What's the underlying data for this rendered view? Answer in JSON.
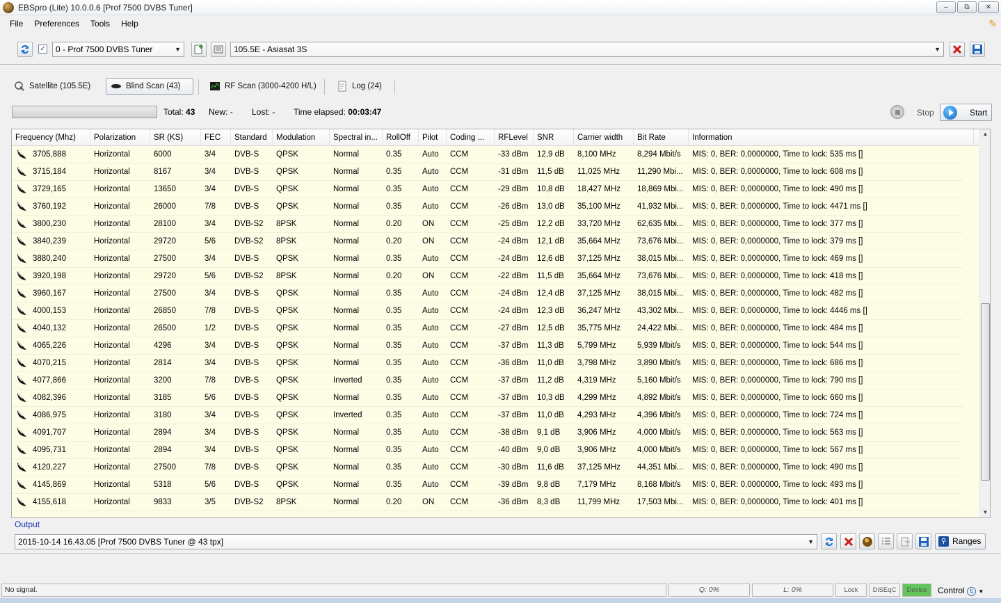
{
  "window": {
    "title": "EBSpro (Lite) 10.0.0.6 [Prof 7500 DVBS Tuner]",
    "min": "–",
    "max": "⧉",
    "close": "✕"
  },
  "menu": [
    "File",
    "Preferences",
    "Tools",
    "Help"
  ],
  "toolbar": {
    "tuner": "0 - Prof 7500 DVBS Tuner",
    "satellite": "105.5E - Asiasat 3S"
  },
  "tabs": [
    {
      "label": "Satellite (105.5E)"
    },
    {
      "label": "Blind Scan (43)"
    },
    {
      "label": "RF Scan (3000-4200 H/L)"
    },
    {
      "label": "Log (24)"
    }
  ],
  "scan": {
    "total_label": "Total:",
    "total": "43",
    "new_label": "New:",
    "new": "-",
    "lost_label": "Lost:",
    "lost": "-",
    "elapsed_label": "Time elapsed:",
    "elapsed": "00:03:47",
    "stop": "Stop",
    "start": "Start"
  },
  "columns": [
    "Frequency (Mhz)",
    "Polarization",
    "SR (KS)",
    "FEC",
    "Standard",
    "Modulation",
    "Spectral in...",
    "RollOff",
    "Pilot",
    "Coding ...",
    "RFLevel",
    "SNR",
    "Carrier width",
    "Bit Rate",
    "Information"
  ],
  "rows": [
    [
      "3705,888",
      "Horizontal",
      "6000",
      "3/4",
      "DVB-S",
      "QPSK",
      "Normal",
      "0.35",
      "Auto",
      "CCM",
      "-33 dBm",
      "12,9 dB",
      "8,100 MHz",
      "8,294 Mbit/s",
      "MIS: 0, BER: 0,0000000, Time to lock: 535 ms []"
    ],
    [
      "3715,184",
      "Horizontal",
      "8167",
      "3/4",
      "DVB-S",
      "QPSK",
      "Normal",
      "0.35",
      "Auto",
      "CCM",
      "-31 dBm",
      "11,5 dB",
      "11,025 MHz",
      "11,290 Mbi...",
      "MIS: 0, BER: 0,0000000, Time to lock: 608 ms []"
    ],
    [
      "3729,165",
      "Horizontal",
      "13650",
      "3/4",
      "DVB-S",
      "QPSK",
      "Normal",
      "0.35",
      "Auto",
      "CCM",
      "-29 dBm",
      "10,8 dB",
      "18,427 MHz",
      "18,869 Mbi...",
      "MIS: 0, BER: 0,0000000, Time to lock: 490 ms []"
    ],
    [
      "3760,192",
      "Horizontal",
      "26000",
      "7/8",
      "DVB-S",
      "QPSK",
      "Normal",
      "0.35",
      "Auto",
      "CCM",
      "-26 dBm",
      "13,0 dB",
      "35,100 MHz",
      "41,932 Mbi...",
      "MIS: 0, BER: 0,0000000, Time to lock: 4471 ms []"
    ],
    [
      "3800,230",
      "Horizontal",
      "28100",
      "3/4",
      "DVB-S2",
      "8PSK",
      "Normal",
      "0.20",
      "ON",
      "CCM",
      "-25 dBm",
      "12,2 dB",
      "33,720 MHz",
      "62,635 Mbi...",
      "MIS: 0, BER: 0,0000000, Time to lock: 377 ms []"
    ],
    [
      "3840,239",
      "Horizontal",
      "29720",
      "5/6",
      "DVB-S2",
      "8PSK",
      "Normal",
      "0.20",
      "ON",
      "CCM",
      "-24 dBm",
      "12,1 dB",
      "35,664 MHz",
      "73,676 Mbi...",
      "MIS: 0, BER: 0,0000000, Time to lock: 379 ms []"
    ],
    [
      "3880,240",
      "Horizontal",
      "27500",
      "3/4",
      "DVB-S",
      "QPSK",
      "Normal",
      "0.35",
      "Auto",
      "CCM",
      "-24 dBm",
      "12,6 dB",
      "37,125 MHz",
      "38,015 Mbi...",
      "MIS: 0, BER: 0,0000000, Time to lock: 469 ms []"
    ],
    [
      "3920,198",
      "Horizontal",
      "29720",
      "5/6",
      "DVB-S2",
      "8PSK",
      "Normal",
      "0.20",
      "ON",
      "CCM",
      "-22 dBm",
      "11,5 dB",
      "35,664 MHz",
      "73,676 Mbi...",
      "MIS: 0, BER: 0,0000000, Time to lock: 418 ms []"
    ],
    [
      "3960,167",
      "Horizontal",
      "27500",
      "3/4",
      "DVB-S",
      "QPSK",
      "Normal",
      "0.35",
      "Auto",
      "CCM",
      "-24 dBm",
      "12,4 dB",
      "37,125 MHz",
      "38,015 Mbi...",
      "MIS: 0, BER: 0,0000000, Time to lock: 482 ms []"
    ],
    [
      "4000,153",
      "Horizontal",
      "26850",
      "7/8",
      "DVB-S",
      "QPSK",
      "Normal",
      "0.35",
      "Auto",
      "CCM",
      "-24 dBm",
      "12,3 dB",
      "36,247 MHz",
      "43,302 Mbi...",
      "MIS: 0, BER: 0,0000000, Time to lock: 4446 ms []"
    ],
    [
      "4040,132",
      "Horizontal",
      "26500",
      "1/2",
      "DVB-S",
      "QPSK",
      "Normal",
      "0.35",
      "Auto",
      "CCM",
      "-27 dBm",
      "12,5 dB",
      "35,775 MHz",
      "24,422 Mbi...",
      "MIS: 0, BER: 0,0000000, Time to lock: 484 ms []"
    ],
    [
      "4065,226",
      "Horizontal",
      "4296",
      "3/4",
      "DVB-S",
      "QPSK",
      "Normal",
      "0.35",
      "Auto",
      "CCM",
      "-37 dBm",
      "11,3 dB",
      "5,799 MHz",
      "5,939 Mbit/s",
      "MIS: 0, BER: 0,0000000, Time to lock: 544 ms []"
    ],
    [
      "4070,215",
      "Horizontal",
      "2814",
      "3/4",
      "DVB-S",
      "QPSK",
      "Normal",
      "0.35",
      "Auto",
      "CCM",
      "-36 dBm",
      "11,0 dB",
      "3,798 MHz",
      "3,890 Mbit/s",
      "MIS: 0, BER: 0,0000000, Time to lock: 686 ms []"
    ],
    [
      "4077,866",
      "Horizontal",
      "3200",
      "7/8",
      "DVB-S",
      "QPSK",
      "Inverted",
      "0.35",
      "Auto",
      "CCM",
      "-37 dBm",
      "11,2 dB",
      "4,319 MHz",
      "5,160 Mbit/s",
      "MIS: 0, BER: 0,0000000, Time to lock: 790 ms []"
    ],
    [
      "4082,396",
      "Horizontal",
      "3185",
      "5/6",
      "DVB-S",
      "QPSK",
      "Normal",
      "0.35",
      "Auto",
      "CCM",
      "-37 dBm",
      "10,3 dB",
      "4,299 MHz",
      "4,892 Mbit/s",
      "MIS: 0, BER: 0,0000000, Time to lock: 660 ms []"
    ],
    [
      "4086,975",
      "Horizontal",
      "3180",
      "3/4",
      "DVB-S",
      "QPSK",
      "Inverted",
      "0.35",
      "Auto",
      "CCM",
      "-37 dBm",
      "11,0 dB",
      "4,293 MHz",
      "4,396 Mbit/s",
      "MIS: 0, BER: 0,0000000, Time to lock: 724 ms []"
    ],
    [
      "4091,707",
      "Horizontal",
      "2894",
      "3/4",
      "DVB-S",
      "QPSK",
      "Normal",
      "0.35",
      "Auto",
      "CCM",
      "-38 dBm",
      "9,1 dB",
      "3,906 MHz",
      "4,000 Mbit/s",
      "MIS: 0, BER: 0,0000000, Time to lock: 563 ms []"
    ],
    [
      "4095,731",
      "Horizontal",
      "2894",
      "3/4",
      "DVB-S",
      "QPSK",
      "Normal",
      "0.35",
      "Auto",
      "CCM",
      "-40 dBm",
      "9,0 dB",
      "3,906 MHz",
      "4,000 Mbit/s",
      "MIS: 0, BER: 0,0000000, Time to lock: 567 ms []"
    ],
    [
      "4120,227",
      "Horizontal",
      "27500",
      "7/8",
      "DVB-S",
      "QPSK",
      "Normal",
      "0.35",
      "Auto",
      "CCM",
      "-30 dBm",
      "11,6 dB",
      "37,125 MHz",
      "44,351 Mbi...",
      "MIS: 0, BER: 0,0000000, Time to lock: 490 ms []"
    ],
    [
      "4145,869",
      "Horizontal",
      "5318",
      "5/6",
      "DVB-S",
      "QPSK",
      "Normal",
      "0.35",
      "Auto",
      "CCM",
      "-39 dBm",
      "9,8 dB",
      "7,179 MHz",
      "8,168 Mbit/s",
      "MIS: 0, BER: 0,0000000, Time to lock: 493 ms []"
    ],
    [
      "4155,618",
      "Horizontal",
      "9833",
      "3/5",
      "DVB-S2",
      "8PSK",
      "Normal",
      "0.20",
      "ON",
      "CCM",
      "-36 dBm",
      "8,3 dB",
      "11,799 MHz",
      "17,503 Mbi...",
      "MIS: 0, BER: 0,0000000, Time to lock: 401 ms []"
    ]
  ],
  "output": {
    "label": "Output",
    "value": "2015-10-14 16.43.05 [Prof 7500 DVBS Tuner @ 43 tpx]",
    "ranges": "Ranges"
  },
  "statusbar": {
    "signal": "No signal.",
    "q": "Q: 0%",
    "l": "L: 0%",
    "lock": "Lock",
    "diseqc": "DiSEqC",
    "device": "Device",
    "control": "Control"
  },
  "colors": {
    "row_background": "#fdfde6",
    "output_label": "#1a35b5",
    "device_ok": "#63c45a"
  }
}
